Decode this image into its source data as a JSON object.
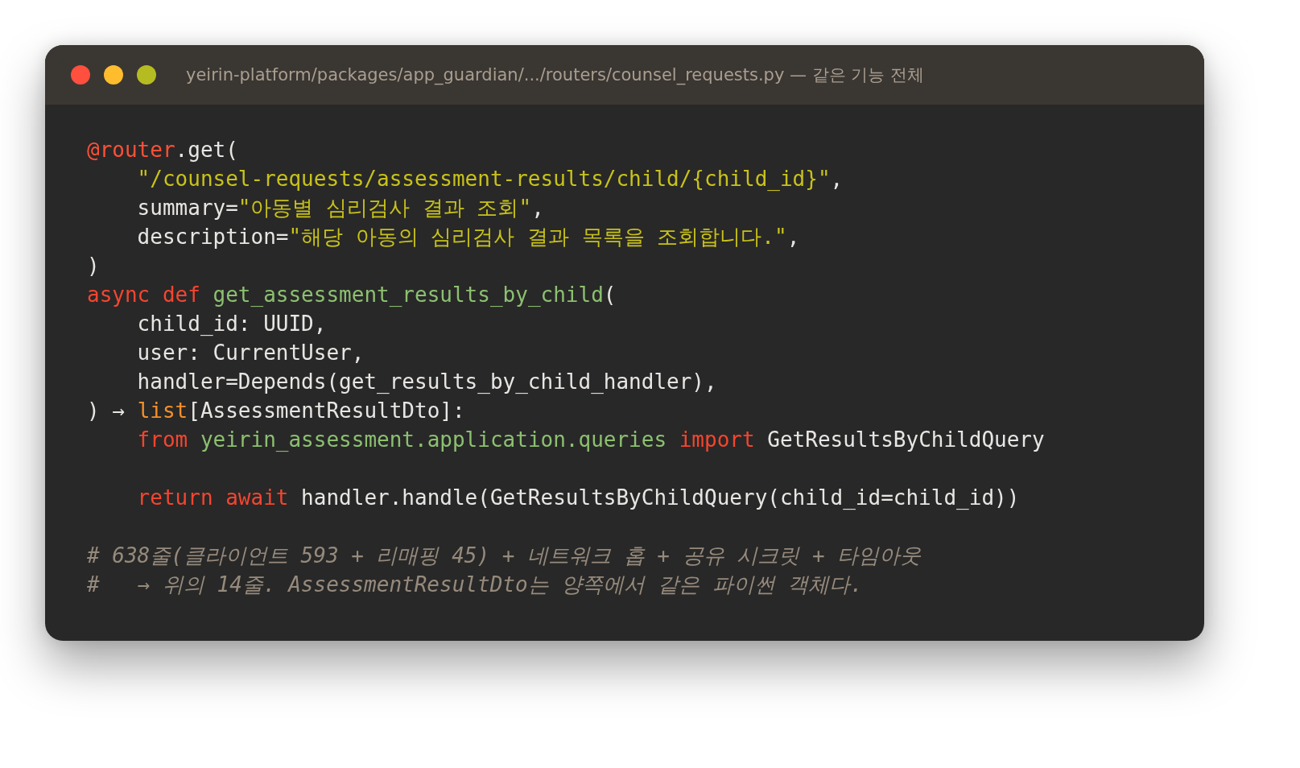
{
  "window": {
    "title": "yeirin-platform/packages/app_guardian/.../routers/counsel_requests.py — 같은 기능 전체",
    "controls": [
      {
        "kind": "close"
      },
      {
        "kind": "minimize"
      },
      {
        "kind": "zoom"
      }
    ]
  },
  "lines": [
    {
      "kind": "code",
      "tokens": [
        {
          "kind": "decorator",
          "text": "@router"
        },
        {
          "kind": "plain",
          "text": ".get("
        }
      ]
    },
    {
      "kind": "code",
      "tokens": [
        {
          "kind": "string",
          "text": "    \"/counsel-requests/assessment-results/child/{child_id}\""
        },
        {
          "kind": "plain",
          "text": ","
        }
      ]
    },
    {
      "kind": "code",
      "tokens": [
        {
          "kind": "plain",
          "text": "    summary="
        },
        {
          "kind": "string",
          "text": "\"아동별 심리검사 결과 조회\""
        },
        {
          "kind": "plain",
          "text": ","
        }
      ]
    },
    {
      "kind": "code",
      "tokens": [
        {
          "kind": "plain",
          "text": "    description="
        },
        {
          "kind": "string",
          "text": "\"해당 아동의 심리검사 결과 목록을 조회합니다.\""
        },
        {
          "kind": "plain",
          "text": ","
        }
      ]
    },
    {
      "kind": "code",
      "tokens": [
        {
          "kind": "plain",
          "text": ")"
        }
      ]
    },
    {
      "kind": "code",
      "tokens": [
        {
          "kind": "keyword",
          "text": "async def "
        },
        {
          "kind": "function",
          "text": "get_assessment_results_by_child"
        },
        {
          "kind": "plain",
          "text": "("
        }
      ]
    },
    {
      "kind": "code",
      "tokens": [
        {
          "kind": "plain",
          "text": "    child_id: UUID,"
        }
      ]
    },
    {
      "kind": "code",
      "tokens": [
        {
          "kind": "plain",
          "text": "    user: CurrentUser,"
        }
      ]
    },
    {
      "kind": "code",
      "tokens": [
        {
          "kind": "plain",
          "text": "    handler=Depends(get_results_by_child_handler),"
        }
      ]
    },
    {
      "kind": "code",
      "tokens": [
        {
          "kind": "plain",
          "text": ") → "
        },
        {
          "kind": "builtin",
          "text": "list"
        },
        {
          "kind": "plain",
          "text": "[AssessmentResultDto]:"
        }
      ]
    },
    {
      "kind": "code",
      "tokens": [
        {
          "kind": "keyword",
          "text": "    from "
        },
        {
          "kind": "function",
          "text": "yeirin_assessment.application.queries "
        },
        {
          "kind": "keyword",
          "text": "import "
        },
        {
          "kind": "plain",
          "text": "GetResultsByChildQuery"
        }
      ]
    },
    {
      "kind": "blank"
    },
    {
      "kind": "code",
      "tokens": [
        {
          "kind": "keyword",
          "text": "    return await "
        },
        {
          "kind": "plain",
          "text": "handler.handle(GetResultsByChildQuery(child_id=child_id))"
        }
      ]
    },
    {
      "kind": "blank"
    },
    {
      "kind": "comment",
      "tokens": [
        {
          "kind": "comment",
          "text": "# 638줄(클라이언트 593 + 리매핑 45) + 네트워크 홉 + 공유 시크릿 + 타임아웃"
        }
      ]
    },
    {
      "kind": "comment",
      "tokens": [
        {
          "kind": "comment",
          "text": "#   → 위의 14줄. AssessmentResultDto는 양쪽에서 같은 파이썬 객체다."
        }
      ]
    }
  ]
}
